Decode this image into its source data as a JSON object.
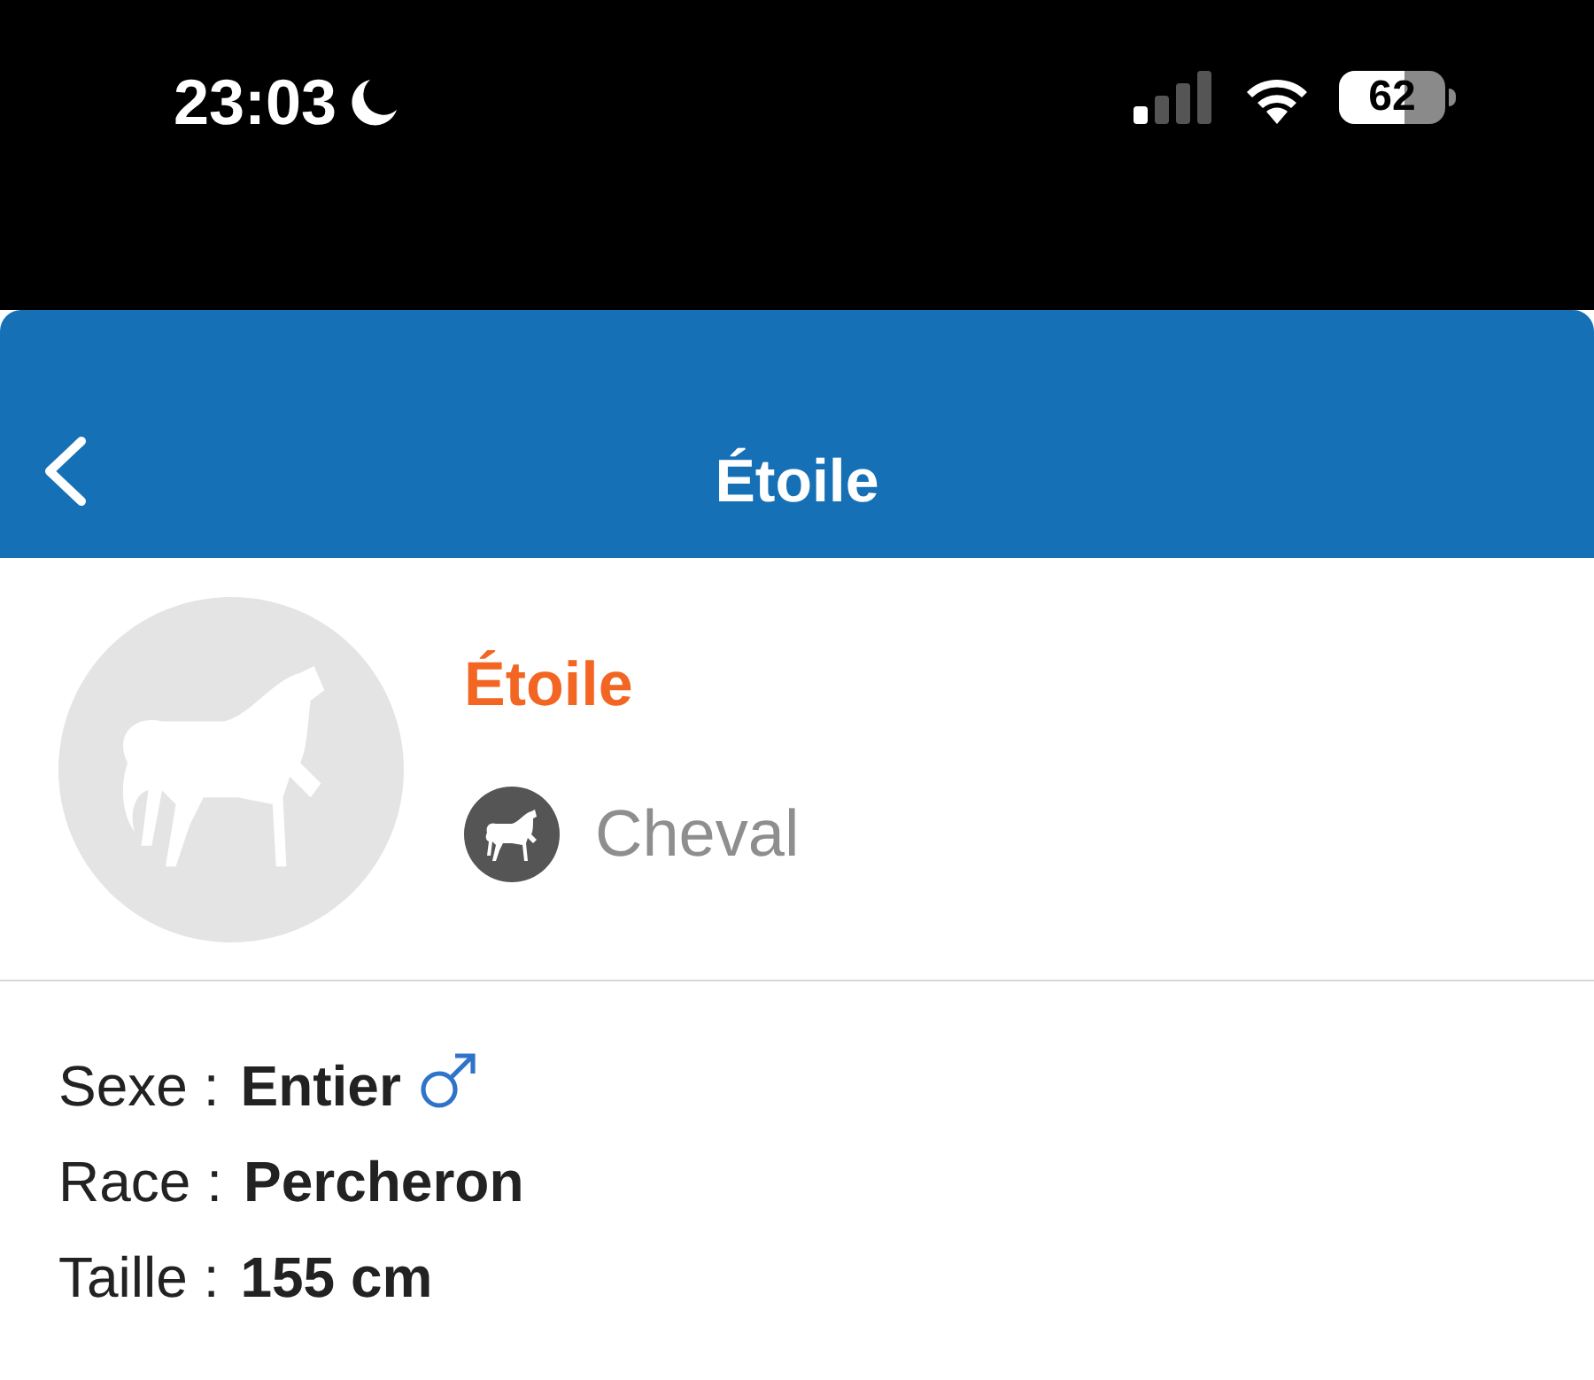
{
  "status_bar": {
    "time": "23:03",
    "battery": "62"
  },
  "header": {
    "title": "Étoile"
  },
  "profile": {
    "name": "Étoile",
    "species": "Cheval"
  },
  "details": [
    {
      "label": "Sexe :",
      "value": "Entier",
      "kind": "sex"
    },
    {
      "label": "Race :",
      "value": "Percheron",
      "kind": "plain"
    },
    {
      "label": "Taille :",
      "value": "155 cm",
      "kind": "plain"
    }
  ]
}
